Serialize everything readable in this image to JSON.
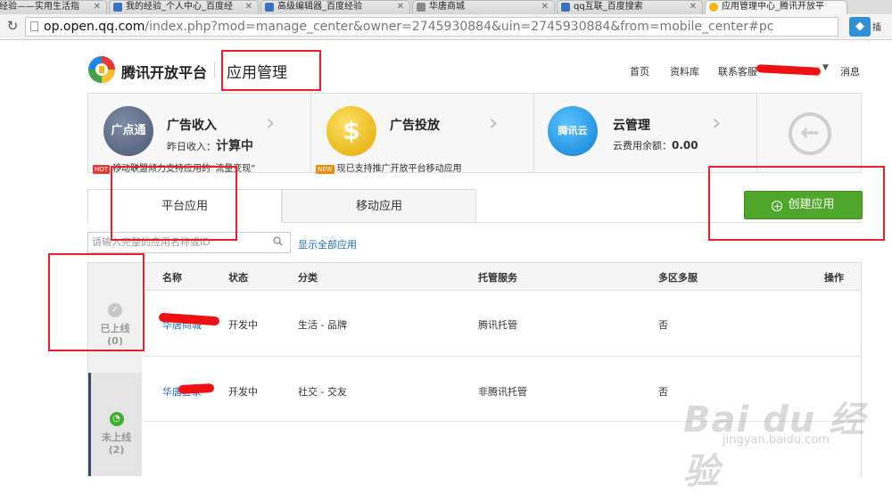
{
  "browser": {
    "tabs": [
      {
        "label": "经验——实用生活指"
      },
      {
        "label": "我的经验_个人中心_百度经"
      },
      {
        "label": "高级编辑器_百度经验"
      },
      {
        "label": "华唐商城"
      },
      {
        "label": "qq互联_百度搜索"
      },
      {
        "label": "应用管理中心_腾讯开放平"
      }
    ],
    "url_host": "op.open.qq.com",
    "url_rest": "/index.php?mod=manage_center&owner=2745930884&uin=2745930884&from=mobile_center#pc",
    "extension_label": "插"
  },
  "header": {
    "logo_text": "腾讯开放平台",
    "page_title": "应用管理",
    "nav": {
      "home": "首页",
      "docs": "资料库",
      "support": "联系客服",
      "messages": "消息"
    }
  },
  "cards": [
    {
      "icon_text": "广点通",
      "title": "广告收入",
      "sub_label": "昨日收入：",
      "sub_value": "计算中",
      "notice_badge": "HOT",
      "notice": "移动联盟倾力支持应用的“流量变现”"
    },
    {
      "icon_text": "$",
      "title": "广告投放",
      "notice_badge": "NEW",
      "notice": "现已支持推广开放平台移动应用"
    },
    {
      "icon_text": "腾讯云",
      "title": "云管理",
      "sub_label": "云费用余额：",
      "sub_value": "0.00"
    }
  ],
  "tabs": [
    {
      "label": "平台应用"
    },
    {
      "label": "移动应用"
    }
  ],
  "create_button": "创建应用",
  "search": {
    "placeholder": "请输入完整的应用名称或ID"
  },
  "show_all": "显示全部应用",
  "sidebar": [
    {
      "label": "已上线",
      "count": "(0)"
    },
    {
      "label": "未上线",
      "count": "(2)"
    }
  ],
  "table": {
    "columns": [
      "名称",
      "状态",
      "分类",
      "托管服务",
      "多区多服",
      "操作"
    ],
    "rows": [
      {
        "name": "华唐商城",
        "status": "开发中",
        "category": "生活 - 品牌",
        "hosting": "腾讯托管",
        "multi_zone": "否"
      },
      {
        "name": "华唐登录",
        "status": "开发中",
        "category": "社交 - 交友",
        "hosting": "非腾讯托管",
        "multi_zone": "否"
      }
    ]
  },
  "watermark": {
    "brand": "Bai du 经验",
    "url": "jingyan.baidu.com"
  },
  "colors": {
    "accent_green": "#4ea62b",
    "link_blue": "#1a6fc7",
    "annotation_red": "#e8202a"
  }
}
